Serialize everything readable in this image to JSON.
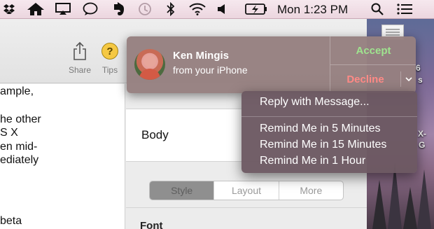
{
  "menubar": {
    "clock": "Mon 1:23 PM",
    "icons": [
      "dropbox-icon",
      "home-icon",
      "airplay-icon",
      "messages-icon",
      "evernote-icon",
      "time-machine-icon",
      "bluetooth-icon",
      "wifi-icon",
      "volume-icon",
      "battery-icon",
      "spotlight-icon",
      "notification-center-icon"
    ]
  },
  "toolbar": {
    "share_label": "Share",
    "tips_label": "Tips",
    "tips_glyph": "?"
  },
  "document": {
    "lines": [
      "ample,",
      "",
      "he other",
      "S X",
      "en mid-",
      "ediately",
      "",
      "",
      "beta"
    ]
  },
  "inspector": {
    "paragraph_style": "Body",
    "tabs": [
      {
        "label": "Style",
        "active": true
      },
      {
        "label": "Layout",
        "active": false
      },
      {
        "label": "More",
        "active": false
      }
    ],
    "font_heading": "Font"
  },
  "notification": {
    "caller_name": "Ken Mingis",
    "caller_source": "from your iPhone",
    "accept_label": "Accept",
    "decline_label": "Decline",
    "accept_color": "#9fe48f",
    "decline_color": "#ff8a86"
  },
  "decline_menu": {
    "reply_label": "Reply with Message...",
    "remind_items": [
      "Remind Me in 5 Minutes",
      "Remind Me in 15 Minutes",
      "Remind Me in 1 Hour"
    ]
  },
  "desktop": {
    "fragments": [
      "6",
      "s",
      "X-",
      "G"
    ]
  }
}
